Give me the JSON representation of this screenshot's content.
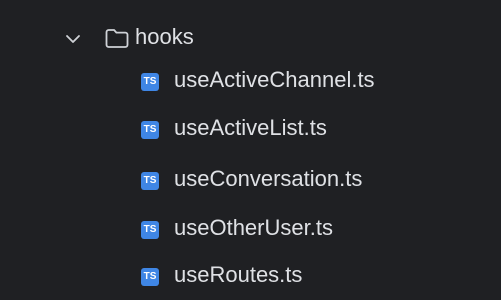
{
  "project_tree": {
    "folder": {
      "name": "hooks",
      "expanded_icon": "chevron-down-icon",
      "icon": "folder-icon"
    },
    "files": [
      {
        "name": "useActiveChannel.ts",
        "icon": "typescript-file-icon",
        "badge": "TS"
      },
      {
        "name": "useActiveList.ts",
        "icon": "typescript-file-icon",
        "badge": "TS"
      },
      {
        "name": "useConversation.ts",
        "icon": "typescript-file-icon",
        "badge": "TS"
      },
      {
        "name": "useOtherUser.ts",
        "icon": "typescript-file-icon",
        "badge": "TS"
      },
      {
        "name": "useRoutes.ts",
        "icon": "typescript-file-icon",
        "badge": "TS"
      }
    ]
  },
  "colors": {
    "background": "#1f2023",
    "text": "#dfe1e5",
    "icon": "#cfd2d7",
    "typescript_badge": "#3f86e5"
  }
}
